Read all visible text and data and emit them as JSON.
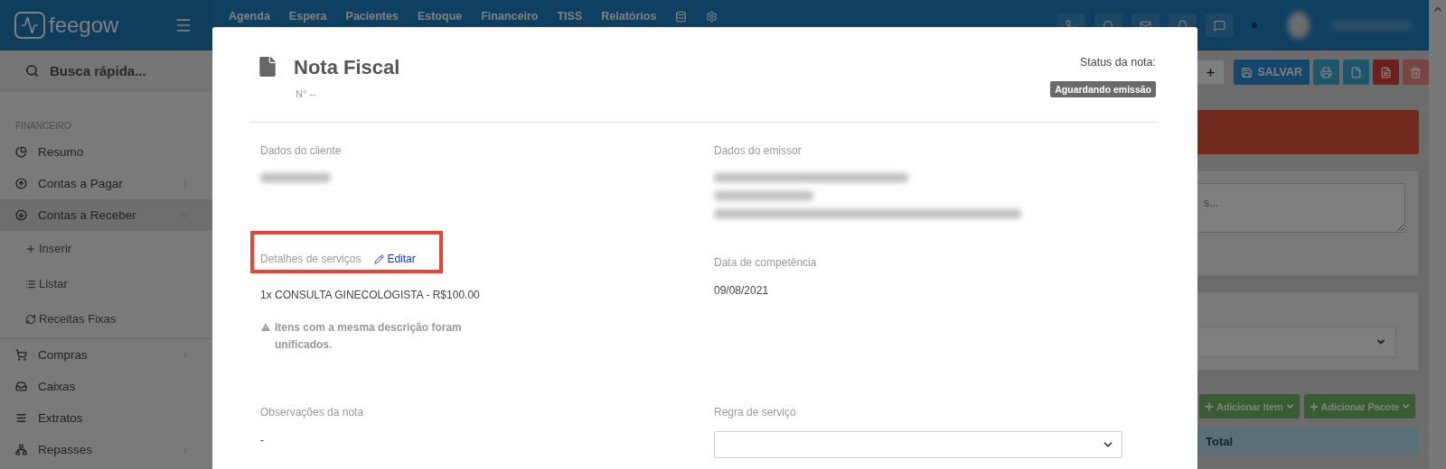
{
  "nav": {
    "logo": "feegow",
    "menu": [
      "Agenda",
      "Espera",
      "Pacientes",
      "Estoque",
      "Financeiro",
      "TISS",
      "Relatórios"
    ]
  },
  "sidebar": {
    "search": {
      "placeholder": "Busca rápida..."
    },
    "section": "FINANCEIRO",
    "items": [
      {
        "label": "Resumo",
        "kind": "link",
        "selected": false
      },
      {
        "label": "Contas a Pagar",
        "kind": "group",
        "expanded": false,
        "selected": false
      },
      {
        "label": "Contas a Receber",
        "kind": "group",
        "expanded": true,
        "selected": true,
        "children": [
          {
            "label": "Inserir"
          },
          {
            "label": "Listar"
          },
          {
            "label": "Receitas Fixas"
          }
        ]
      },
      {
        "label": "Compras",
        "kind": "group",
        "expanded": false,
        "selected": false
      },
      {
        "label": "Caixas",
        "kind": "link",
        "selected": false
      },
      {
        "label": "Extratos",
        "kind": "link",
        "selected": false
      },
      {
        "label": "Repasses",
        "kind": "group",
        "expanded": false,
        "selected": false
      }
    ]
  },
  "page": {
    "toolbar": [
      {
        "kind": "add"
      },
      {
        "kind": "save",
        "label": "SALVAR"
      },
      {
        "kind": "print"
      },
      {
        "kind": "file"
      },
      {
        "kind": "pdf"
      },
      {
        "kind": "trash"
      }
    ],
    "notes": {
      "placeholder": "s..."
    },
    "actions": [
      "Adicionar Item",
      "Adicionar Pacote"
    ],
    "table_header": "Total"
  },
  "modal": {
    "title": "Nota Fiscal",
    "number": "N° --",
    "status_label": "Status da nota:",
    "status": "Aguardando emissão",
    "client": {
      "label": "Dados do cliente"
    },
    "emitter": {
      "label": "Dados do emissor"
    },
    "services": {
      "label": "Detalhes de serviços",
      "edit": "Editar",
      "highlighted": true,
      "value": "1x CONSULTA GINECOLOGISTA - R$100.00",
      "note": "Itens com a mesma descrição foram unificados."
    },
    "competence": {
      "label": "Data de competência",
      "value": "09/08/2021"
    },
    "observations": {
      "label": "Observações da nota",
      "value": "-"
    },
    "rule": {
      "label": "Regra de serviço"
    }
  }
}
